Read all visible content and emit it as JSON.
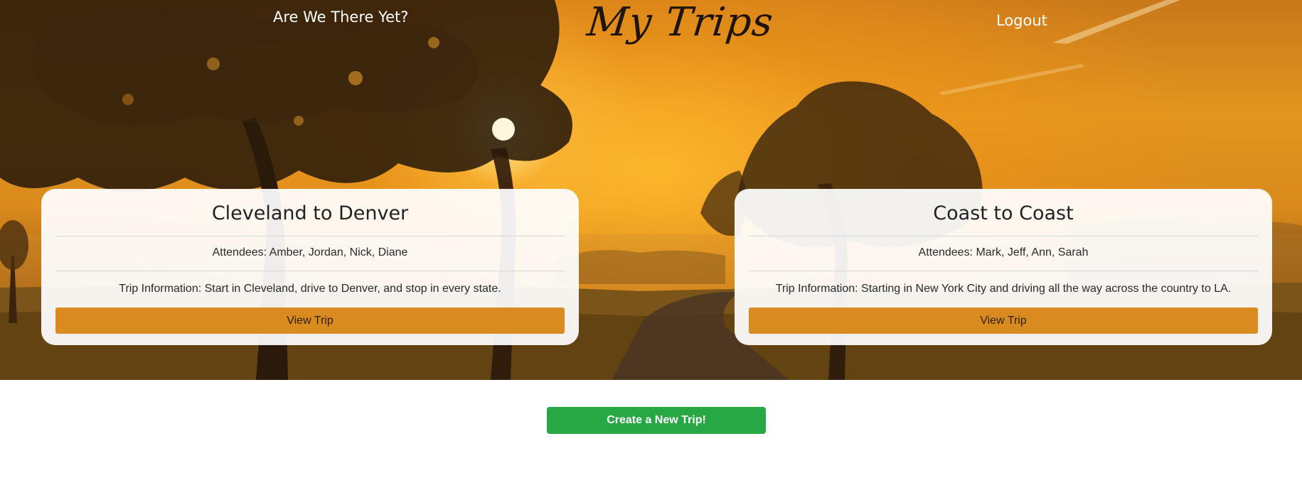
{
  "nav": {
    "brand": "Are We There Yet?",
    "title": "My Trips",
    "logout": "Logout"
  },
  "trips": [
    {
      "title": "Cleveland to Denver",
      "attendees": "Attendees: Amber, Jordan, Nick, Diane",
      "info": "Trip Information: Start in Cleveland, drive to Denver, and stop in every state.",
      "button": "View Trip"
    },
    {
      "title": "Coast to Coast",
      "attendees": "Attendees: Mark, Jeff, Ann, Sarah",
      "info": "Trip Information: Starting in New York City and driving all the way across the country to LA.",
      "button": "View Trip"
    }
  ],
  "create_button": "Create a New Trip!",
  "colors": {
    "card_button": "#d98b1f",
    "create_button": "#28a745",
    "title_text": "#1e1407"
  }
}
